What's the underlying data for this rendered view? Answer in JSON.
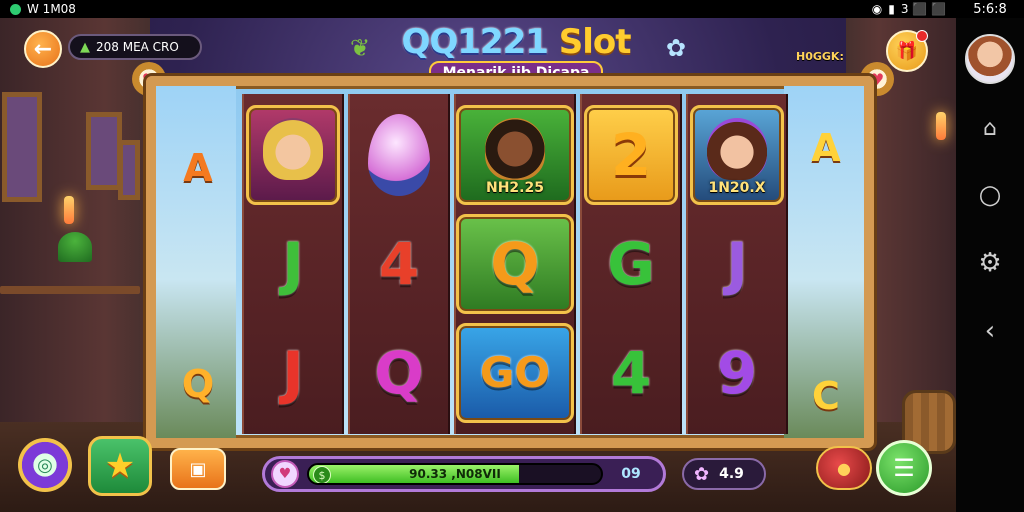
{
  "status_bar": {
    "left_text": "W 1M08",
    "right_text": "3 ⬛ ⬛",
    "clock": "5:6:8"
  },
  "header": {
    "balance": "208 MEA CRO",
    "logo_title_part1": "QQ1221",
    "logo_title_part2": "Slot",
    "logo_subtitle": "Menarik jib Dicapa",
    "promo_text": "H0GGK:"
  },
  "reels": [
    [
      {
        "type": "portrait",
        "name": "golden-queen",
        "caption": ""
      },
      {
        "type": "letter",
        "value": "J",
        "color": "#3fbf3a"
      },
      {
        "type": "letter",
        "value": "J",
        "color": "#e8342a"
      }
    ],
    [
      {
        "type": "gem",
        "name": "pink-gem",
        "caption": ""
      },
      {
        "type": "letter",
        "value": "4",
        "color": "#e8402a"
      },
      {
        "type": "letter",
        "value": "Q",
        "color": "#d93cc8"
      }
    ],
    [
      {
        "type": "portrait",
        "name": "warrior",
        "caption": "NH2.25"
      },
      {
        "type": "letter",
        "value": "Q",
        "color": "#f59a1a"
      },
      {
        "type": "letter",
        "value": "GO",
        "color": "#f59a1a"
      }
    ],
    [
      {
        "type": "letter",
        "value": "2",
        "color": "#ffb020"
      },
      {
        "type": "letter",
        "value": "G",
        "color": "#38c23a"
      },
      {
        "type": "letter",
        "value": "4",
        "color": "#38c23a"
      }
    ],
    [
      {
        "type": "portrait",
        "name": "princess",
        "caption": "1N20.X"
      },
      {
        "type": "letter",
        "value": "J",
        "color": "#9b5be0"
      },
      {
        "type": "letter",
        "value": "9",
        "color": "#a24be6"
      }
    ]
  ],
  "side_symbols": {
    "left_top": "A",
    "left_bottom": "Q",
    "right_top": "A",
    "right_bottom": "C"
  },
  "bottom_bar": {
    "progress_text": "90.33 ,N08VII",
    "progress_fraction": 0.72,
    "bet_value": "09",
    "win_value": "4.9"
  },
  "icons": {
    "back": "arrow-left-icon",
    "gift": "gift-icon",
    "menu": "menu-icon",
    "star": "star-icon",
    "search": "magnifier-icon"
  },
  "colors": {
    "frame": "#d49a52",
    "reel_bg": "#5a2326",
    "progress_fill": "#5fd63a",
    "accent": "#ffcc2e"
  }
}
